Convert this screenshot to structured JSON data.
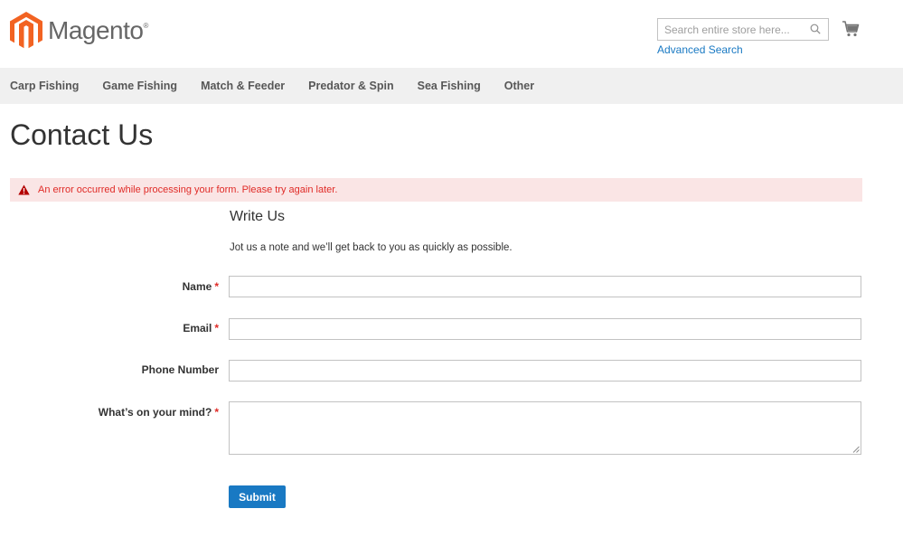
{
  "header": {
    "logo_text": "Magento",
    "logo_mark": "®",
    "search_placeholder": "Search entire store here...",
    "advanced_search": "Advanced Search",
    "icons": {
      "search": "search-icon",
      "cart": "cart-icon",
      "logo": "magento-logo-icon"
    },
    "brand_color": "#f26322"
  },
  "nav": {
    "items": [
      "Carp Fishing",
      "Game Fishing",
      "Match & Feeder",
      "Predator & Spin",
      "Sea Fishing",
      "Other"
    ]
  },
  "page": {
    "title": "Contact Us",
    "error_message": "An error occurred while processing your form. Please try again later."
  },
  "form": {
    "legend": "Write Us",
    "note": "Jot us a note and we’ll get back to you as quickly as possible.",
    "fields": {
      "name": {
        "label": "Name",
        "required_mark": "*",
        "value": ""
      },
      "email": {
        "label": "Email",
        "required_mark": "*",
        "value": ""
      },
      "phone": {
        "label": "Phone Number",
        "value": ""
      },
      "comment": {
        "label": "What’s on your mind?",
        "required_mark": "*",
        "value": ""
      }
    },
    "submit_label": "Submit"
  },
  "colors": {
    "accent": "#1979c3",
    "error_bg": "#fae5e5",
    "error_text": "#e02b27"
  }
}
